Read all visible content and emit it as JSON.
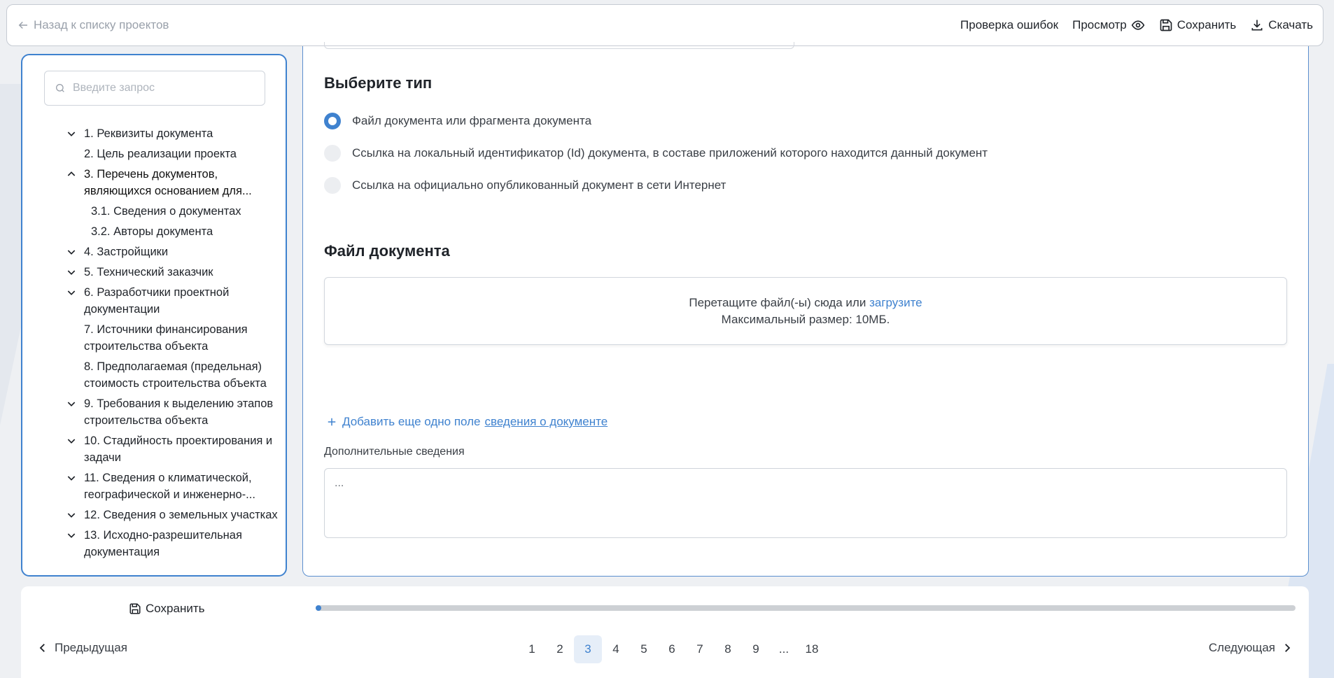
{
  "topbar": {
    "back_label": "Назад к списку проектов",
    "check_errors": "Проверка ошибок",
    "preview": "Просмотр",
    "save": "Сохранить",
    "download": "Скачать"
  },
  "sidebar": {
    "search_placeholder": "Введите запрос",
    "items": [
      {
        "label": "1. Реквизиты документа",
        "chevron": "down"
      },
      {
        "label": "2. Цель реализации проекта",
        "chevron": "none"
      },
      {
        "label": "3. Перечень документов, являющихся основанием для...",
        "chevron": "up"
      },
      {
        "label": "3.1. Сведения о документах",
        "chevron": "none"
      },
      {
        "label": "3.2. Авторы документа",
        "chevron": "none"
      },
      {
        "label": "4. Застройщики",
        "chevron": "down"
      },
      {
        "label": "5. Технический заказчик",
        "chevron": "down"
      },
      {
        "label": "6. Разработчики проектной документации",
        "chevron": "down"
      },
      {
        "label": "7. Источники финансирования строительства объекта",
        "chevron": "none"
      },
      {
        "label": "8. Предполагаемая (предельная) стоимость строительства объекта",
        "chevron": "none"
      },
      {
        "label": "9. Требования к выделению этапов строительства объекта",
        "chevron": "down"
      },
      {
        "label": "10. Стадийность проектирования и задачи",
        "chevron": "down"
      },
      {
        "label": "11. Сведения о климатической, географической и инженерно-...",
        "chevron": "down"
      },
      {
        "label": "12. Сведения о земельных участках",
        "chevron": "down"
      },
      {
        "label": "13. Исходно-разрешительная документация",
        "chevron": "down"
      }
    ]
  },
  "main": {
    "type_heading": "Выберите тип",
    "type_options": [
      {
        "label": "Файл документа или фрагмента документа",
        "checked": true
      },
      {
        "label": "Ссылка на локальный идентификатор (Id) документа, в составе приложений которого находится данный документ",
        "checked": false
      },
      {
        "label": "Ссылка на официально опубликованный документ в сети Интернет",
        "checked": false
      }
    ],
    "file_heading": "Файл документа",
    "dropzone": {
      "text": "Перетащите файл(-ы) сюда или",
      "link": "загрузите",
      "max_size": "Максимальный размер: 10МБ."
    },
    "add_field": {
      "prefix": "Добавить еще одно поле",
      "link": "сведения о документе"
    },
    "additional_label": "Дополнительные сведения",
    "additional_placeholder": "..."
  },
  "bottom": {
    "save": "Сохранить",
    "progress": 0.005,
    "prev": "Предыдущая",
    "next": "Следующая",
    "pages": [
      "1",
      "2",
      "3",
      "4",
      "5",
      "6",
      "7",
      "8",
      "9",
      "...",
      "18"
    ],
    "current_page": "3"
  },
  "colors": {
    "accent": "#3f82cf",
    "text": "#1f2329",
    "muted": "#9aa1ab"
  }
}
